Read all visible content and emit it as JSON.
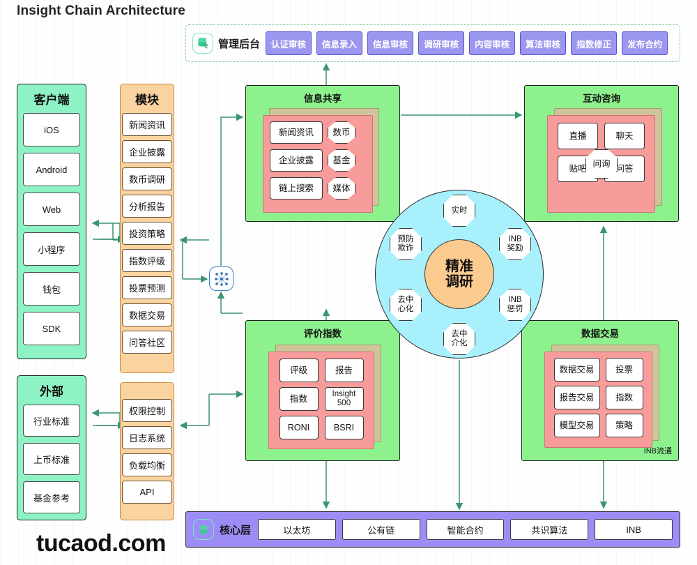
{
  "title": "Insight Chain Architecture",
  "watermark": "tucaod.com",
  "admin": {
    "icon": "database-wrench-icon",
    "label": "管理后台",
    "buttons": [
      "认证审核",
      "信息录入",
      "信息审核",
      "调研审核",
      "内容审核",
      "算法审核",
      "指数修正",
      "发布合约"
    ]
  },
  "client_column": {
    "title": "客户端",
    "items": [
      "iOS",
      "Android",
      "Web",
      "小程序",
      "钱包",
      "SDK"
    ]
  },
  "external_column": {
    "title": "外部",
    "items": [
      "行业标准",
      "上币标准",
      "基金参考"
    ]
  },
  "module_column": {
    "title": "模块",
    "items": [
      "新闻资讯",
      "企业披露",
      "数币调研",
      "分析报告",
      "投资策略",
      "指数评级",
      "投票预测",
      "数据交易",
      "问答社区"
    ]
  },
  "infra_column": {
    "items": [
      "权限控制",
      "日志系统",
      "负载均衡",
      "API"
    ]
  },
  "panels": {
    "info_share": {
      "title": "信息共享",
      "rects": [
        "新闻资讯",
        "企业披露",
        "链上搜索"
      ],
      "octs": [
        "数币",
        "基金",
        "媒体"
      ]
    },
    "interaction": {
      "title": "互动咨询",
      "rects": [
        "直播",
        "聊天",
        "贴吧",
        "问答"
      ],
      "center_oct": "问询"
    },
    "rating_index": {
      "title": "评价指数",
      "rects": [
        "评级",
        "报告",
        "指数",
        "Insight 500",
        "RONI",
        "BSRI"
      ]
    },
    "data_trade": {
      "title": "数据交易",
      "rects": [
        "数据交易",
        "投票",
        "报告交易",
        "指数",
        "模型交易",
        "策略"
      ],
      "note": "INB流通"
    }
  },
  "hub": {
    "core_line1": "精准",
    "core_line2": "调研",
    "satellites": [
      {
        "line1": "实时",
        "line2": ""
      },
      {
        "line1": "INB",
        "line2": "奖励"
      },
      {
        "line1": "INB",
        "line2": "惩罚"
      },
      {
        "line1": "去中",
        "line2": "介化"
      },
      {
        "line1": "去中",
        "line2": "心化"
      },
      {
        "line1": "预防",
        "line2": "欺诈"
      }
    ]
  },
  "mesh_node": {
    "icon": "network-mesh-icon"
  },
  "core_layer": {
    "icon": "layers-stack-icon",
    "label": "核心层",
    "items": [
      "以太坊",
      "公有链",
      "智能合约",
      "共识算法",
      "INB"
    ]
  },
  "colors": {
    "panel_green": "#8df28d",
    "panel_inner_red": "#f79b9b",
    "panel_shadow": "#cfc49a",
    "client_green": "#8df2c4",
    "module_orange": "#fbd3a0",
    "hub_blue": "#a8f0fb",
    "hub_core_orange": "#fbcb8f",
    "core_purple": "#9b8df5",
    "admin_btn_purple": "#9b97f0",
    "arrow_green": "#3c9470"
  }
}
